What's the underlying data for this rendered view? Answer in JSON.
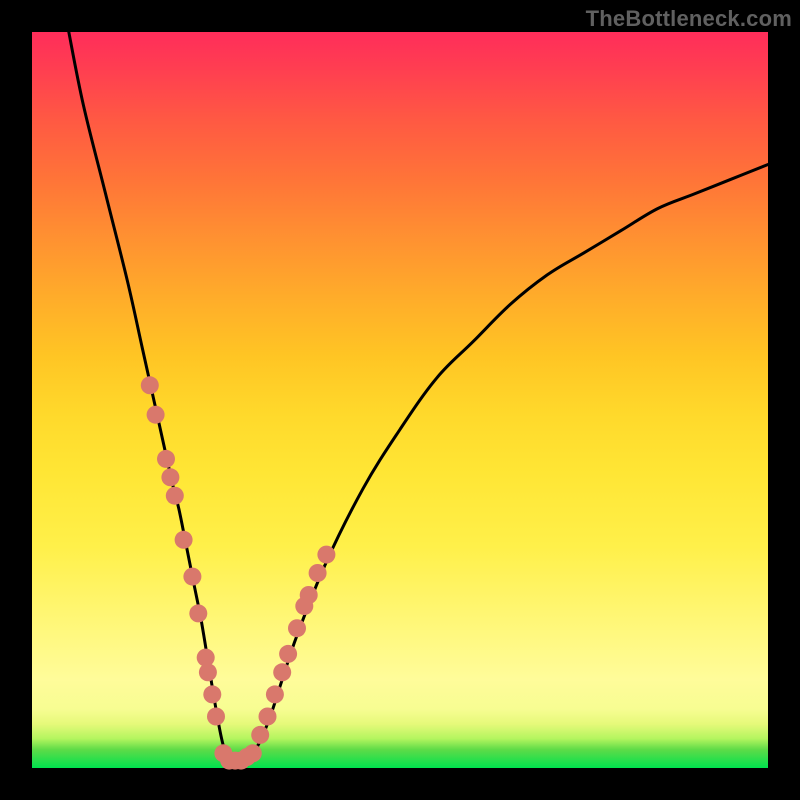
{
  "watermark": "TheBottleneck.com",
  "chart_data": {
    "type": "line",
    "title": "",
    "xlabel": "",
    "ylabel": "",
    "xlim": [
      0,
      100
    ],
    "ylim": [
      0,
      100
    ],
    "series": [
      {
        "name": "curve",
        "x": [
          5,
          7,
          10,
          13,
          15,
          17,
          19,
          20,
          21,
          22,
          23,
          24,
          25,
          26,
          27,
          28,
          30,
          32,
          34,
          36,
          40,
          45,
          50,
          55,
          60,
          65,
          70,
          75,
          80,
          85,
          90,
          95,
          100
        ],
        "y": [
          100,
          90,
          78,
          66,
          57,
          48,
          39,
          35,
          30,
          25,
          20,
          14,
          8,
          3,
          1,
          1,
          2,
          6,
          12,
          18,
          28,
          38,
          46,
          53,
          58,
          63,
          67,
          70,
          73,
          76,
          78,
          80,
          82
        ]
      }
    ],
    "markers": {
      "name": "highlight-dots",
      "color": "#d9786c",
      "points": [
        {
          "x": 16.0,
          "y": 52.0
        },
        {
          "x": 16.8,
          "y": 48.0
        },
        {
          "x": 18.2,
          "y": 42.0
        },
        {
          "x": 18.8,
          "y": 39.5
        },
        {
          "x": 19.4,
          "y": 37.0
        },
        {
          "x": 20.6,
          "y": 31.0
        },
        {
          "x": 21.8,
          "y": 26.0
        },
        {
          "x": 22.6,
          "y": 21.0
        },
        {
          "x": 23.6,
          "y": 15.0
        },
        {
          "x": 23.9,
          "y": 13.0
        },
        {
          "x": 24.5,
          "y": 10.0
        },
        {
          "x": 25.0,
          "y": 7.0
        },
        {
          "x": 26.0,
          "y": 2.0
        },
        {
          "x": 26.8,
          "y": 1.0
        },
        {
          "x": 27.6,
          "y": 1.0
        },
        {
          "x": 28.4,
          "y": 1.0
        },
        {
          "x": 29.2,
          "y": 1.5
        },
        {
          "x": 30.0,
          "y": 2.0
        },
        {
          "x": 31.0,
          "y": 4.5
        },
        {
          "x": 32.0,
          "y": 7.0
        },
        {
          "x": 33.0,
          "y": 10.0
        },
        {
          "x": 34.0,
          "y": 13.0
        },
        {
          "x": 34.8,
          "y": 15.5
        },
        {
          "x": 36.0,
          "y": 19.0
        },
        {
          "x": 37.0,
          "y": 22.0
        },
        {
          "x": 37.6,
          "y": 23.5
        },
        {
          "x": 38.8,
          "y": 26.5
        },
        {
          "x": 40.0,
          "y": 29.0
        }
      ]
    }
  }
}
